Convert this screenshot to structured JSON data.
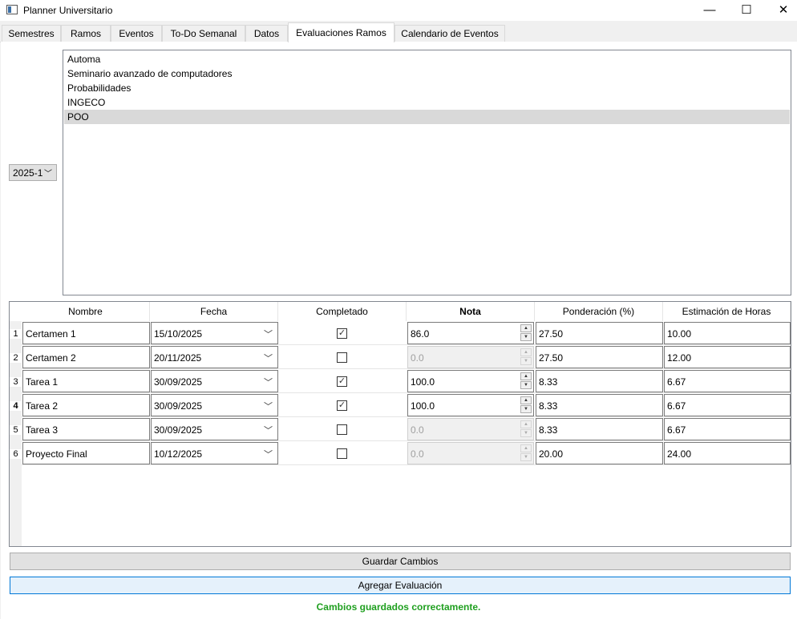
{
  "window": {
    "title": "Planner Universitario",
    "minimize": "—",
    "maximize": "☐",
    "close": "✕"
  },
  "tabs": [
    "Semestres",
    "Ramos",
    "Eventos",
    "To-Do Semanal",
    "Datos",
    "Evaluaciones Ramos",
    "Calendario de Eventos"
  ],
  "active_tab": "Evaluaciones Ramos",
  "semester_select": {
    "value": "2025-1"
  },
  "courses": [
    "Automa",
    "Seminario avanzado de computadores",
    "Probabilidades",
    "INGECO",
    "POO"
  ],
  "selected_course": "POO",
  "table": {
    "headers": [
      "Nombre",
      "Fecha",
      "Completado",
      "Nota",
      "Ponderación (%)",
      "Estimación de Horas"
    ],
    "rows": [
      {
        "num": "1",
        "nombre": "Certamen 1",
        "fecha": "15/10/2025",
        "completado": true,
        "nota": "86.0",
        "ponderacion": "27.50",
        "horas": "10.00"
      },
      {
        "num": "2",
        "nombre": "Certamen 2",
        "fecha": "20/11/2025",
        "completado": false,
        "nota": "0.0",
        "ponderacion": "27.50",
        "horas": "12.00"
      },
      {
        "num": "3",
        "nombre": "Tarea 1",
        "fecha": "30/09/2025",
        "completado": true,
        "nota": "100.0",
        "ponderacion": "8.33",
        "horas": "6.67"
      },
      {
        "num": "4",
        "nombre": "Tarea 2",
        "fecha": "30/09/2025",
        "completado": true,
        "nota": "100.0",
        "ponderacion": "8.33",
        "horas": "6.67"
      },
      {
        "num": "5",
        "nombre": "Tarea 3",
        "fecha": "30/09/2025",
        "completado": false,
        "nota": "0.0",
        "ponderacion": "8.33",
        "horas": "6.67"
      },
      {
        "num": "6",
        "nombre": "Proyecto Final",
        "fecha": "10/12/2025",
        "completado": false,
        "nota": "0.0",
        "ponderacion": "20.00",
        "horas": "24.00"
      }
    ]
  },
  "buttons": {
    "save": "Guardar Cambios",
    "add": "Agregar Evaluación"
  },
  "status": {
    "text": "Cambios guardados correctamente.",
    "color": "#1f9f1f"
  },
  "icons": {
    "chevron": "chevron-down-icon",
    "check": "check-icon",
    "spin_up": "spin-up-icon",
    "spin_down": "spin-down-icon"
  }
}
